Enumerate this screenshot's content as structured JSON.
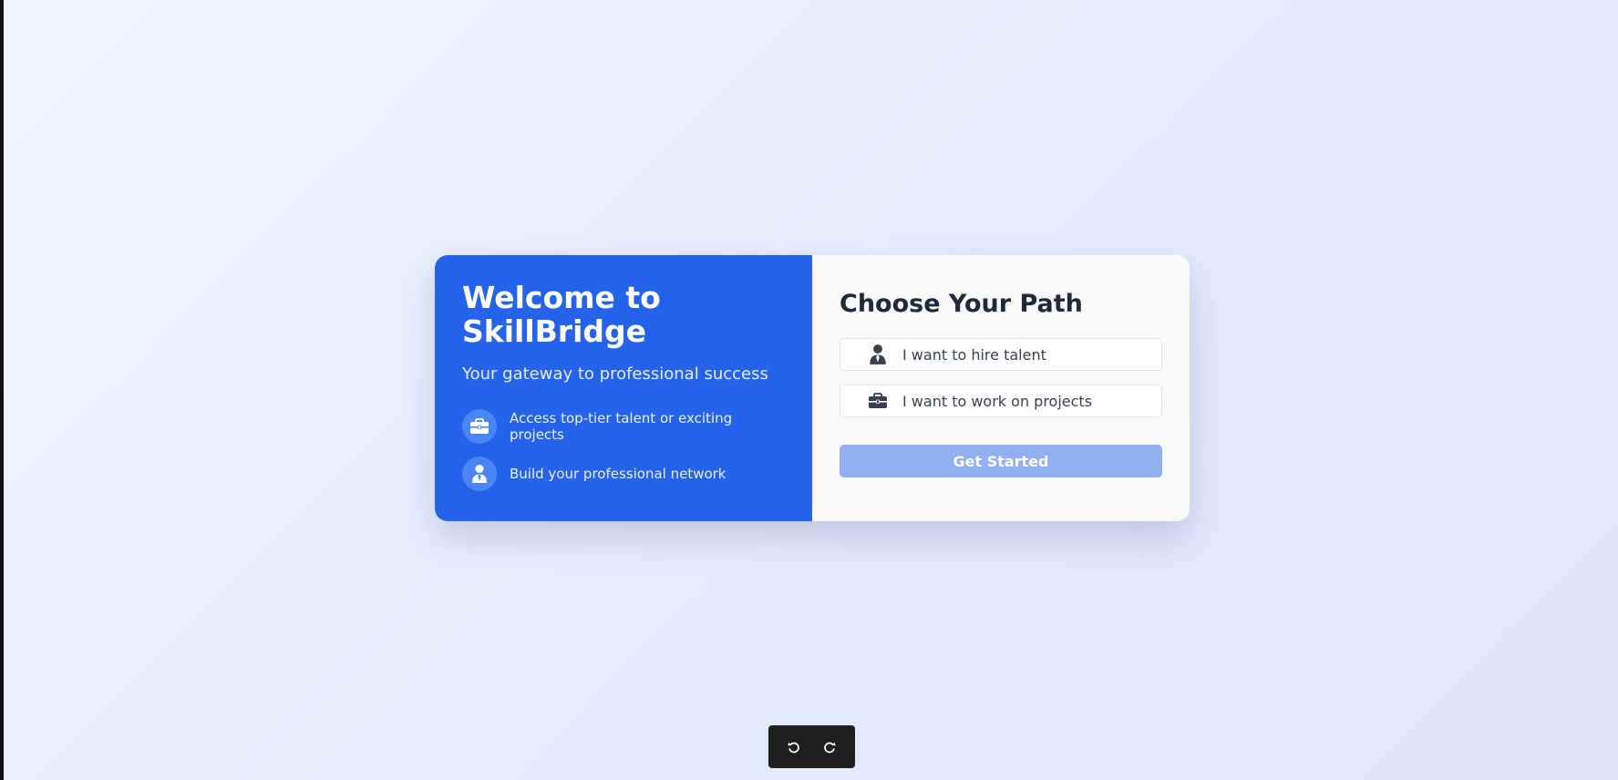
{
  "welcome": {
    "title": "Welcome to SkillBridge",
    "tagline": "Your gateway to professional success",
    "features": [
      {
        "icon": "briefcase-icon",
        "text": "Access top-tier talent or exciting projects"
      },
      {
        "icon": "user-tie-icon",
        "text": "Build your professional network"
      }
    ]
  },
  "path": {
    "title": "Choose Your Path",
    "options": [
      {
        "icon": "user-tie-icon",
        "label": "I want to hire talent"
      },
      {
        "icon": "briefcase-icon",
        "label": "I want to work on projects"
      }
    ],
    "cta_label": "Get Started"
  },
  "toolbar": {
    "undo_icon": "undo-icon",
    "redo_icon": "redo-icon"
  },
  "colors": {
    "primary": "#2563eb",
    "primary_disabled": "#93b0f2",
    "panel_bg": "#f8f9fb",
    "heading": "#1f2937"
  }
}
